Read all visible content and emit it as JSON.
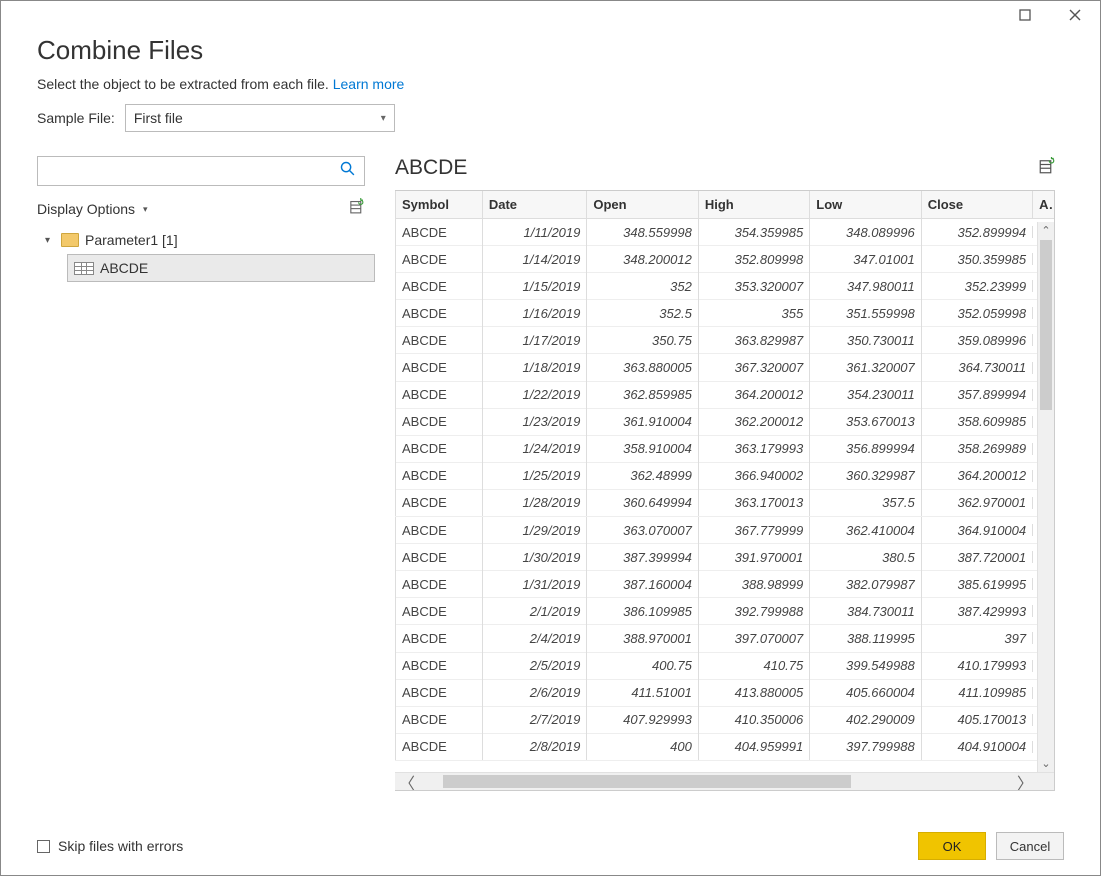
{
  "title": "Combine Files",
  "subtitle_text": "Select the object to be extracted from each file.",
  "learn_more": "Learn more",
  "sample_label": "Sample File:",
  "sample_value": "First file",
  "display_options": "Display Options",
  "tree": {
    "folder_label": "Parameter1 [1]",
    "table_label": "ABCDE"
  },
  "preview_title": "ABCDE",
  "columns": [
    "Symbol",
    "Date",
    "Open",
    "High",
    "Low",
    "Close",
    "Ad"
  ],
  "rows": [
    {
      "sym": "ABCDE",
      "date": "1/11/2019",
      "open": "348.559998",
      "high": "354.359985",
      "low": "348.089996",
      "close": "352.899994"
    },
    {
      "sym": "ABCDE",
      "date": "1/14/2019",
      "open": "348.200012",
      "high": "352.809998",
      "low": "347.01001",
      "close": "350.359985"
    },
    {
      "sym": "ABCDE",
      "date": "1/15/2019",
      "open": "352",
      "high": "353.320007",
      "low": "347.980011",
      "close": "352.23999"
    },
    {
      "sym": "ABCDE",
      "date": "1/16/2019",
      "open": "352.5",
      "high": "355",
      "low": "351.559998",
      "close": "352.059998"
    },
    {
      "sym": "ABCDE",
      "date": "1/17/2019",
      "open": "350.75",
      "high": "363.829987",
      "low": "350.730011",
      "close": "359.089996"
    },
    {
      "sym": "ABCDE",
      "date": "1/18/2019",
      "open": "363.880005",
      "high": "367.320007",
      "low": "361.320007",
      "close": "364.730011"
    },
    {
      "sym": "ABCDE",
      "date": "1/22/2019",
      "open": "362.859985",
      "high": "364.200012",
      "low": "354.230011",
      "close": "357.899994"
    },
    {
      "sym": "ABCDE",
      "date": "1/23/2019",
      "open": "361.910004",
      "high": "362.200012",
      "low": "353.670013",
      "close": "358.609985"
    },
    {
      "sym": "ABCDE",
      "date": "1/24/2019",
      "open": "358.910004",
      "high": "363.179993",
      "low": "356.899994",
      "close": "358.269989"
    },
    {
      "sym": "ABCDE",
      "date": "1/25/2019",
      "open": "362.48999",
      "high": "366.940002",
      "low": "360.329987",
      "close": "364.200012"
    },
    {
      "sym": "ABCDE",
      "date": "1/28/2019",
      "open": "360.649994",
      "high": "363.170013",
      "low": "357.5",
      "close": "362.970001"
    },
    {
      "sym": "ABCDE",
      "date": "1/29/2019",
      "open": "363.070007",
      "high": "367.779999",
      "low": "362.410004",
      "close": "364.910004"
    },
    {
      "sym": "ABCDE",
      "date": "1/30/2019",
      "open": "387.399994",
      "high": "391.970001",
      "low": "380.5",
      "close": "387.720001"
    },
    {
      "sym": "ABCDE",
      "date": "1/31/2019",
      "open": "387.160004",
      "high": "388.98999",
      "low": "382.079987",
      "close": "385.619995"
    },
    {
      "sym": "ABCDE",
      "date": "2/1/2019",
      "open": "386.109985",
      "high": "392.799988",
      "low": "384.730011",
      "close": "387.429993"
    },
    {
      "sym": "ABCDE",
      "date": "2/4/2019",
      "open": "388.970001",
      "high": "397.070007",
      "low": "388.119995",
      "close": "397"
    },
    {
      "sym": "ABCDE",
      "date": "2/5/2019",
      "open": "400.75",
      "high": "410.75",
      "low": "399.549988",
      "close": "410.179993"
    },
    {
      "sym": "ABCDE",
      "date": "2/6/2019",
      "open": "411.51001",
      "high": "413.880005",
      "low": "405.660004",
      "close": "411.109985"
    },
    {
      "sym": "ABCDE",
      "date": "2/7/2019",
      "open": "407.929993",
      "high": "410.350006",
      "low": "402.290009",
      "close": "405.170013"
    },
    {
      "sym": "ABCDE",
      "date": "2/8/2019",
      "open": "400",
      "high": "404.959991",
      "low": "397.799988",
      "close": "404.910004"
    }
  ],
  "skip_label": "Skip files with errors",
  "ok_label": "OK",
  "cancel_label": "Cancel"
}
